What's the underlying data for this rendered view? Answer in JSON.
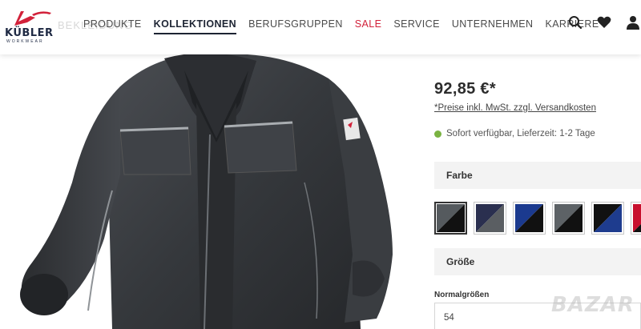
{
  "brand": {
    "logo_text": "KÜBLER",
    "logo_sub": "WORKWEAR",
    "accent": "#d2213a"
  },
  "nav": {
    "ghost_text": "BEKLEIDUNG",
    "items": [
      {
        "label": "PRODUKTE"
      },
      {
        "label": "KOLLEKTIONEN"
      },
      {
        "label": "BERUFSGRUPPEN"
      },
      {
        "label": "SALE"
      },
      {
        "label": "SERVICE"
      },
      {
        "label": "UNTERNEHMEN"
      },
      {
        "label": "KARRIERE"
      }
    ],
    "active": "KOLLEKTIONEN"
  },
  "header_icons": [
    "search-icon",
    "heart-icon",
    "user-icon"
  ],
  "product": {
    "price": "92,85 €*",
    "price_note": "*Preise inkl. MwSt. zzgl. Versandkosten",
    "availability": "Sofort verfügbar, Lieferzeit: 1-2 Tage",
    "availability_color": "#7ab342"
  },
  "color_section": {
    "label": "Farbe",
    "swatches": [
      {
        "colors": [
          "#555a5e",
          "#111111"
        ],
        "selected": true
      },
      {
        "colors": [
          "#2a2f4f",
          "#5a5e62"
        ],
        "selected": false
      },
      {
        "colors": [
          "#1b3a8f",
          "#111111"
        ],
        "selected": false
      },
      {
        "colors": [
          "#5d6266",
          "#111111"
        ],
        "selected": false
      },
      {
        "colors": [
          "#111111",
          "#1e3c8e"
        ],
        "selected": false
      },
      {
        "colors": [
          "#c8102e",
          "#111111"
        ],
        "selected": false
      }
    ]
  },
  "size_section": {
    "label": "Größe",
    "group_label": "Normalgrößen",
    "selected_value": "54"
  },
  "watermark": "BAZAR"
}
